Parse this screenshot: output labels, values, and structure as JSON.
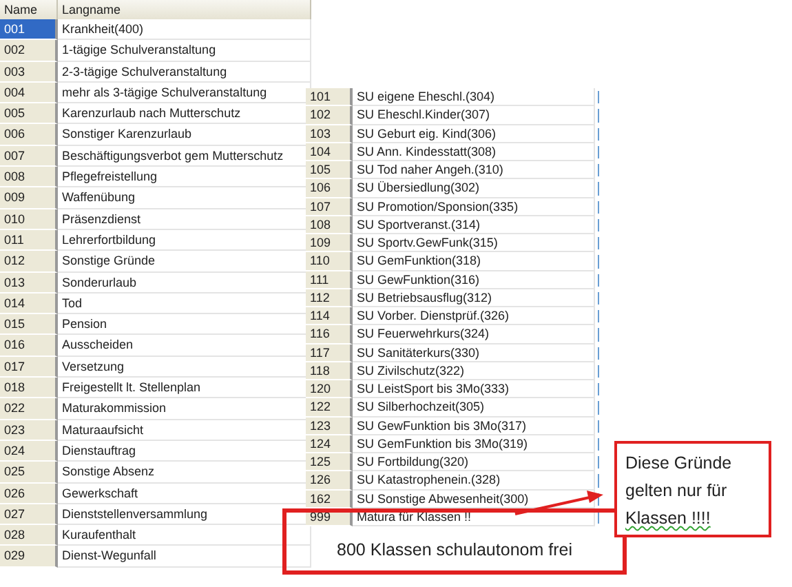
{
  "left_table": {
    "columns": [
      "Name",
      "Langname"
    ],
    "rows": [
      {
        "name": "001",
        "langname": "Krankheit(400)",
        "selected": true
      },
      {
        "name": "002",
        "langname": "1-tägige Schulveranstaltung",
        "selected": false
      },
      {
        "name": "003",
        "langname": "2-3-tägige Schulveranstaltung",
        "selected": false
      },
      {
        "name": "004",
        "langname": "mehr als 3-tägige Schulveranstaltung",
        "selected": false
      },
      {
        "name": "005",
        "langname": "Karenzurlaub nach Mutterschutz",
        "selected": false
      },
      {
        "name": "006",
        "langname": "Sonstiger Karenzurlaub",
        "selected": false
      },
      {
        "name": "007",
        "langname": "Beschäftigungsverbot gem Mutterschutz",
        "selected": false
      },
      {
        "name": "008",
        "langname": "Pflegefreistellung",
        "selected": false
      },
      {
        "name": "009",
        "langname": "Waffenübung",
        "selected": false
      },
      {
        "name": "010",
        "langname": "Präsenzdienst",
        "selected": false
      },
      {
        "name": "011",
        "langname": "Lehrerfortbildung",
        "selected": false
      },
      {
        "name": "012",
        "langname": "Sonstige Gründe",
        "selected": false
      },
      {
        "name": "013",
        "langname": "Sonderurlaub",
        "selected": false
      },
      {
        "name": "014",
        "langname": "Tod",
        "selected": false
      },
      {
        "name": "015",
        "langname": "Pension",
        "selected": false
      },
      {
        "name": "016",
        "langname": "Ausscheiden",
        "selected": false
      },
      {
        "name": "017",
        "langname": "Versetzung",
        "selected": false
      },
      {
        "name": "018",
        "langname": "Freigestellt lt. Stellenplan",
        "selected": false
      },
      {
        "name": "022",
        "langname": "Maturakommission",
        "selected": false
      },
      {
        "name": "023",
        "langname": "Maturaaufsicht",
        "selected": false
      },
      {
        "name": "024",
        "langname": "Dienstauftrag",
        "selected": false
      },
      {
        "name": "025",
        "langname": "Sonstige Absenz",
        "selected": false
      },
      {
        "name": "026",
        "langname": "Gewerkschaft",
        "selected": false
      },
      {
        "name": "027",
        "langname": "Dienststellenversammlung",
        "selected": false
      },
      {
        "name": "028",
        "langname": "Kuraufenthalt",
        "selected": false
      },
      {
        "name": "029",
        "langname": "Dienst-Wegunfall",
        "selected": false
      }
    ]
  },
  "right_table": {
    "rows": [
      {
        "name": "101",
        "langname": "SU eigene Eheschl.(304)",
        "selected": false
      },
      {
        "name": "102",
        "langname": "SU Eheschl.Kinder(307)",
        "selected": false
      },
      {
        "name": "103",
        "langname": "SU Geburt eig. Kind(306)",
        "selected": false
      },
      {
        "name": "104",
        "langname": "SU Ann. Kindesstatt(308)",
        "selected": false
      },
      {
        "name": "105",
        "langname": "SU Tod naher Angeh.(310)",
        "selected": false
      },
      {
        "name": "106",
        "langname": "SU Übersiedlung(302)",
        "selected": false
      },
      {
        "name": "107",
        "langname": "SU Promotion/Sponsion(335)",
        "selected": false
      },
      {
        "name": "108",
        "langname": "SU Sportveranst.(314)",
        "selected": false
      },
      {
        "name": "109",
        "langname": "SU Sportv.GewFunk(315)",
        "selected": false
      },
      {
        "name": "110",
        "langname": "SU GemFunktion(318)",
        "selected": false
      },
      {
        "name": "111",
        "langname": "SU GewFunktion(316)",
        "selected": false
      },
      {
        "name": "112",
        "langname": "SU Betriebsausflug(312)",
        "selected": false
      },
      {
        "name": "114",
        "langname": "SU Vorber. Dienstprüf.(326)",
        "selected": false
      },
      {
        "name": "116",
        "langname": "SU Feuerwehrkurs(324)",
        "selected": false
      },
      {
        "name": "117",
        "langname": "SU Sanitäterkurs(330)",
        "selected": false
      },
      {
        "name": "118",
        "langname": "SU Zivilschutz(322)",
        "selected": false
      },
      {
        "name": "120",
        "langname": "SU LeistSport bis 3Mo(333)",
        "selected": false
      },
      {
        "name": "122",
        "langname": "SU Silberhochzeit(305)",
        "selected": false
      },
      {
        "name": "123",
        "langname": "SU GewFunktion bis 3Mo(317)",
        "selected": false
      },
      {
        "name": "124",
        "langname": "SU GemFunktion bis 3Mo(319)",
        "selected": false
      },
      {
        "name": "125",
        "langname": "SU Fortbildung(320)",
        "selected": false
      },
      {
        "name": "126",
        "langname": "SU Katastrophenein.(328)",
        "selected": false
      },
      {
        "name": "162",
        "langname": "SU Sonstige Abwesenheit(300)",
        "selected": false
      },
      {
        "name": "999",
        "langname": "Matura für Klassen !!",
        "selected": false
      }
    ]
  },
  "note": {
    "text": "800  Klassen schulautonom frei"
  },
  "callout": {
    "lines": [
      "Diese Gründe",
      "gelten nur für",
      "Klassen !!!!"
    ]
  }
}
